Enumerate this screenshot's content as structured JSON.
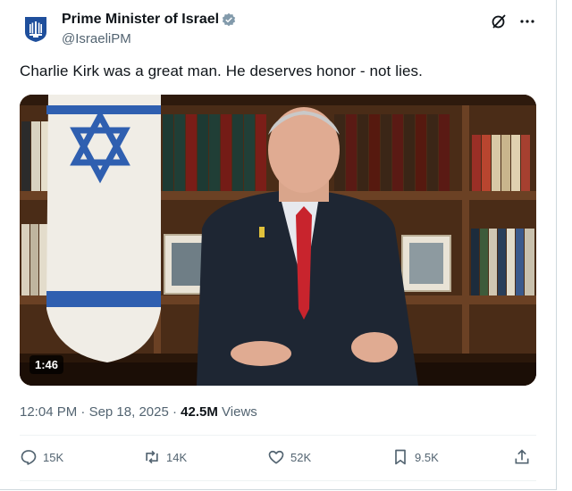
{
  "account": {
    "display_name": "Prime Minister of Israel",
    "handle": "@IsraeliPM"
  },
  "tweet": {
    "text": "Charlie Kirk was a great man. He deserves honor - not lies."
  },
  "media": {
    "duration": "1:46"
  },
  "meta": {
    "time": "12:04 PM",
    "separator": "·",
    "date": "Sep 18, 2025",
    "separator2": "·",
    "views_count": "42.5M",
    "views_label": "Views"
  },
  "actions": {
    "replies": "15K",
    "reposts": "14K",
    "likes": "52K",
    "bookmarks": "9.5K"
  },
  "colors": {
    "verified": "#829aab",
    "text": "#0f1419",
    "secondary": "#536471",
    "flag_blue": "#2f5fb0",
    "tie_red": "#c8242d"
  },
  "icons": [
    "emblem-icon",
    "verified-icon",
    "grok-icon",
    "more-icon",
    "reply-icon",
    "repost-icon",
    "like-icon",
    "bookmark-icon",
    "share-icon"
  ]
}
